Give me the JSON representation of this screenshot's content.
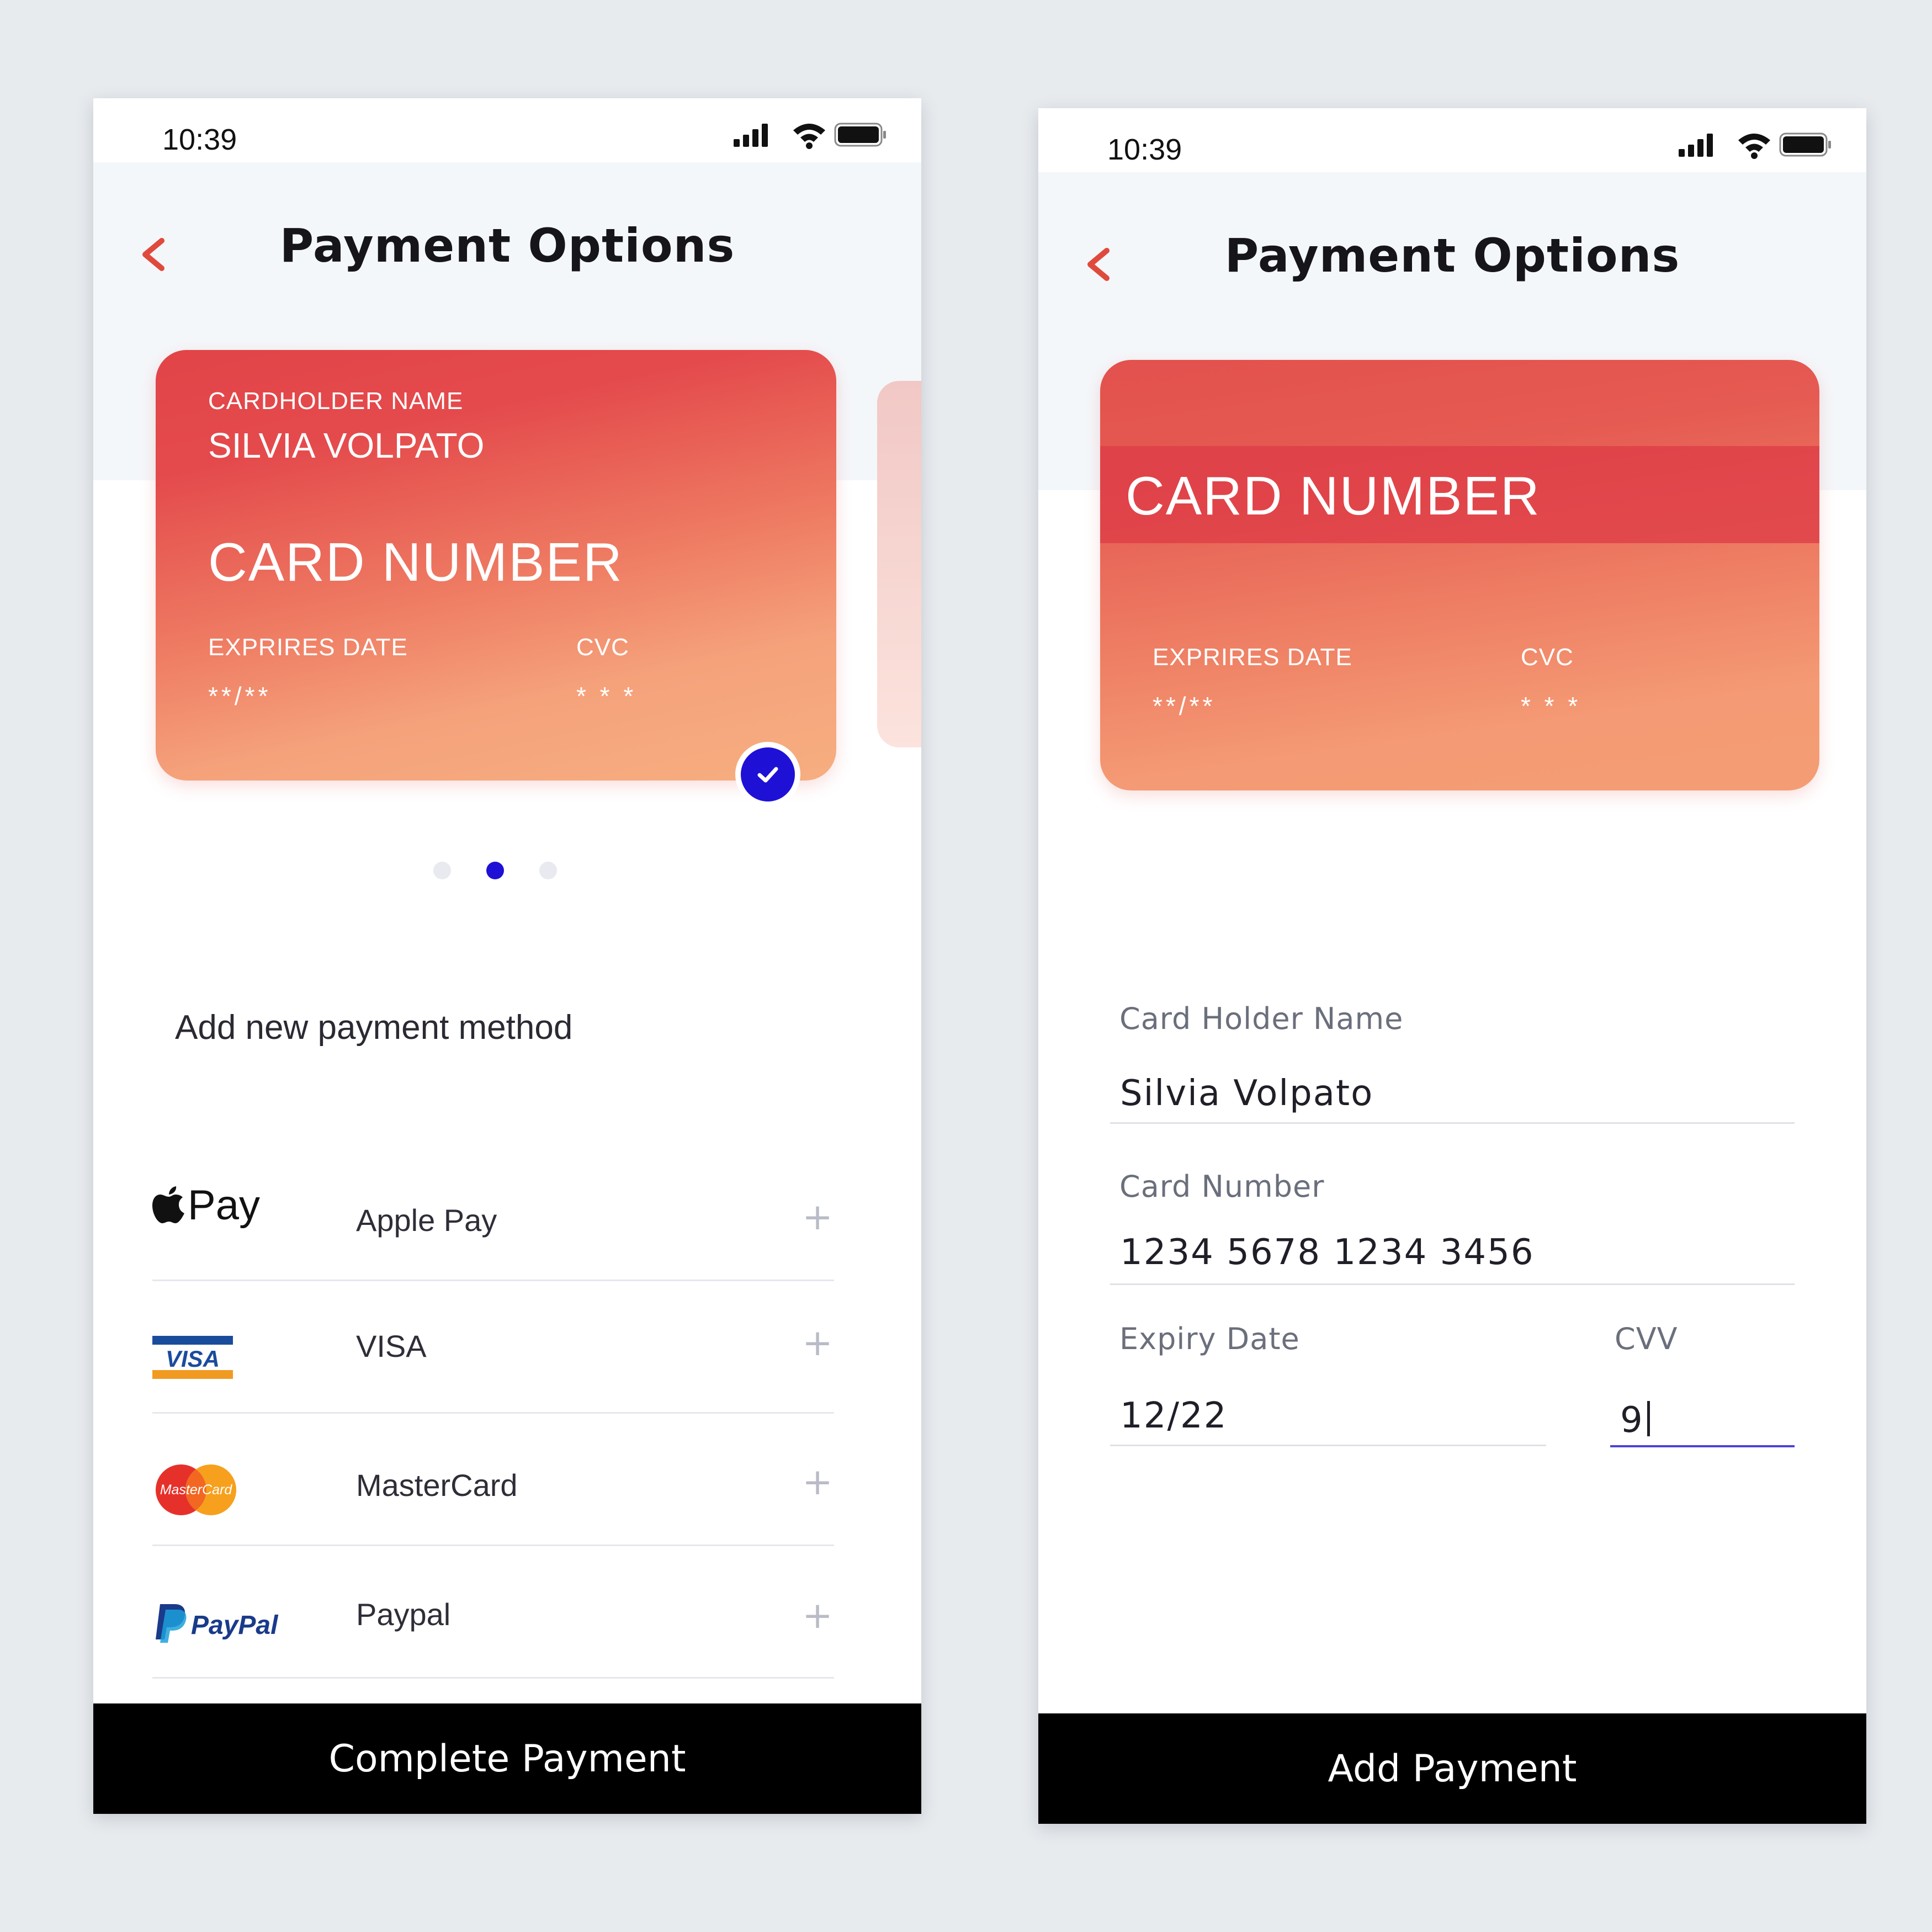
{
  "colors": {
    "accent_back": "#e04a3c",
    "selected_blue": "#1f10d6",
    "card_gradient_top": "#e24448",
    "card_gradient_bottom": "#f6ae80",
    "button_bg": "#000000",
    "focus_underline": "#4a44d9"
  },
  "left_screen": {
    "status_time": "10:39",
    "title": "Payment Options",
    "back_icon": "chevron-left-icon",
    "card": {
      "holder_label": "CARDHOLDER NAME",
      "holder_name": "SILVIA VOLPATO",
      "number": "CARD NUMBER",
      "expiry_label": "EXPRIRES DATE",
      "expiry_value": "**/**",
      "cvc_label": "CVC",
      "cvc_value": "* * *"
    },
    "pager": {
      "count": 3,
      "active_index": 1
    },
    "section_title": "Add new payment method",
    "methods": [
      {
        "logo": "Pay",
        "name": "Apple Pay",
        "icon": "apple-pay-icon"
      },
      {
        "logo": "VISA",
        "name": "VISA",
        "icon": "visa-icon"
      },
      {
        "logo": "MasterCard",
        "name": "MasterCard",
        "icon": "mastercard-icon"
      },
      {
        "logo": "PayPal",
        "name": "Paypal",
        "icon": "paypal-icon"
      }
    ],
    "button": "Complete Payment"
  },
  "right_screen": {
    "status_time": "10:39",
    "title": "Payment Options",
    "card": {
      "number": "CARD NUMBER",
      "expiry_label": "EXPRIRES DATE",
      "expiry_value": "**/**",
      "cvc_label": "CVC",
      "cvc_value": "* * *"
    },
    "form": {
      "holder_label": "Card Holder Name",
      "holder_value": "Silvia Volpato",
      "number_label": "Card Number",
      "number_value": "1234 5678 1234 3456",
      "expiry_label": "Expiry Date",
      "expiry_value": "12/22",
      "cvv_label": "CVV",
      "cvv_value": "9"
    },
    "button": "Add Payment"
  }
}
